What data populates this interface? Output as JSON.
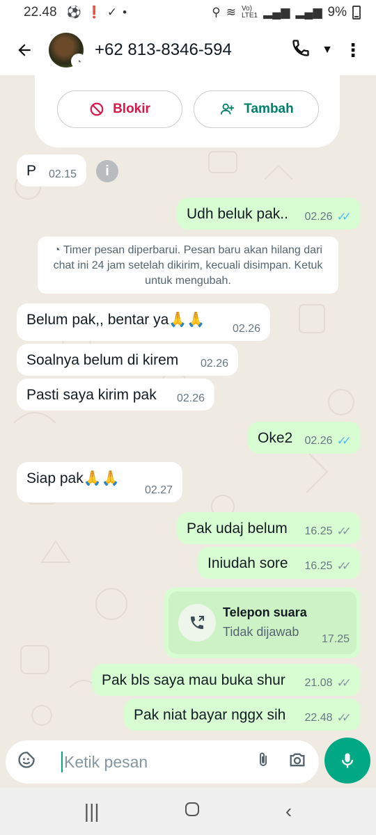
{
  "status_bar": {
    "time": "22.48",
    "battery": "9%",
    "icons": [
      "soccer-icon",
      "alert-icon",
      "check-icon",
      "dot-icon",
      "location-icon",
      "wifi-icon",
      "volte-icon",
      "signal-icon"
    ]
  },
  "header": {
    "contact": "+62 813-8346-594",
    "icons": [
      "back-arrow-icon",
      "phone-icon",
      "dropdown-icon",
      "more-icon"
    ]
  },
  "action_card": {
    "block_label": "Blokir",
    "add_label": "Tambah",
    "colors": {
      "block": "#d9184a",
      "add": "#008069"
    }
  },
  "system_note": {
    "icon": "timer-icon",
    "text": "Timer pesan diperbarui. Pesan baru akan hilang dari chat ini 24 jam setelah dikirim, kecuali disimpan. Ketuk untuk mengubah."
  },
  "messages": [
    {
      "dir": "in",
      "text": "P",
      "time": "02.15"
    },
    {
      "dir": "out",
      "text": "Udh beluk pak..",
      "time": "02.26",
      "status": "read"
    },
    {
      "dir": "in",
      "text": "Belum pak,, bentar ya🙏🙏",
      "time": "02.26"
    },
    {
      "dir": "in",
      "text": "Soalnya belum di kirem",
      "time": "02.26"
    },
    {
      "dir": "in",
      "text": "Pasti saya kirim pak",
      "time": "02.26"
    },
    {
      "dir": "out",
      "text": "Oke2",
      "time": "02.26",
      "status": "read"
    },
    {
      "dir": "in",
      "text": "Siap pak🙏🙏",
      "time": "02.27"
    },
    {
      "dir": "out",
      "text": "Pak udaj belum",
      "time": "16.25",
      "status": "delivered"
    },
    {
      "dir": "out",
      "text": "Iniudah sore",
      "time": "16.25",
      "status": "delivered"
    },
    {
      "dir": "out",
      "text": "Pak bls saya mau buka shur",
      "time": "21.08",
      "status": "delivered"
    },
    {
      "dir": "out",
      "text": "Pak niat bayar nggx sih",
      "time": "22.48",
      "status": "delivered"
    }
  ],
  "call": {
    "title": "Telepon suara",
    "subtitle": "Tidak dijawab",
    "time": "17.25",
    "icon": "missed-call-icon"
  },
  "input": {
    "placeholder": "Ketik pesan",
    "icons": [
      "sticker-icon",
      "attach-icon",
      "camera-icon",
      "mic-icon"
    ],
    "accent": "#00a884"
  },
  "nav": {
    "icons": [
      "recents-icon",
      "home-icon",
      "back-icon"
    ]
  },
  "tick_glyph": "✓✓",
  "colors": {
    "chat_bg": "#efeae2",
    "bubble_out": "#d9fdd3",
    "bubble_in": "#ffffff",
    "tick_read": "#53bdeb",
    "tick_delivered": "#8696a0"
  }
}
